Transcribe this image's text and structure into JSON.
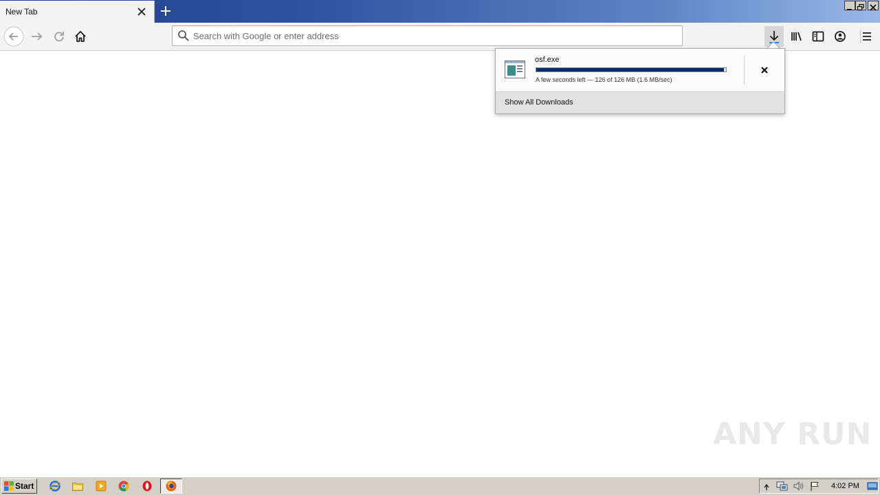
{
  "tab": {
    "title": "New Tab"
  },
  "urlbar": {
    "placeholder": "Search with Google or enter address"
  },
  "download": {
    "file_name": "osf.exe",
    "progress_fraction": 0.99,
    "status": "A few seconds left — 126 of 126 MB (1.6 MB/sec)",
    "show_all_label": "Show All Downloads"
  },
  "watermark": {
    "text": "ANY RUN"
  },
  "taskbar": {
    "start_label": "Start",
    "clock": "4:02 PM",
    "quick_launch": [
      "internet-explorer-icon",
      "file-explorer-icon",
      "media-player-icon",
      "chrome-icon",
      "opera-icon"
    ],
    "active_app": "firefox-icon"
  },
  "colors": {
    "titlebar_start": "#1f3f8a",
    "titlebar_end": "#9ab8e6",
    "progress_fill": "#0b2a6e",
    "download_accent": "#3b7be0"
  }
}
